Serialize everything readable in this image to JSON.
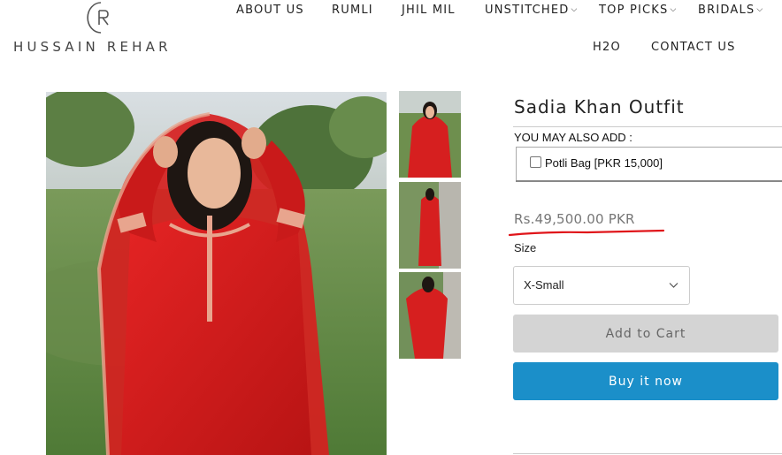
{
  "brand": {
    "name": "HUSSAIN REHAR",
    "logo_icon": "hr-monogram-icon"
  },
  "nav": {
    "items": [
      {
        "label": "ABOUT US",
        "has_dropdown": false
      },
      {
        "label": "RUMLI",
        "has_dropdown": false
      },
      {
        "label": "JHIL MIL",
        "has_dropdown": false
      },
      {
        "label": "UNSTITCHED",
        "has_dropdown": true
      },
      {
        "label": "TOP PICKS",
        "has_dropdown": true
      },
      {
        "label": "BRIDALS",
        "has_dropdown": true
      },
      {
        "label": "H2O",
        "has_dropdown": false
      },
      {
        "label": "CONTACT US",
        "has_dropdown": false
      }
    ],
    "dropdown_icon": "chevron-down-icon"
  },
  "product": {
    "title": "Sadia Khan Outfit",
    "addons_label": "YOU MAY ALSO ADD :",
    "addon_item": "Potli Bag [PKR 15,000]",
    "addon_checked": false,
    "price": "Rs.49,500.00 PKR",
    "size_label": "Size",
    "size_selected": "X-Small",
    "add_to_cart": "Add to Cart",
    "buy_now": "Buy it now"
  },
  "colors": {
    "outfit_red": "#d81e1e",
    "buy_button": "#1b8fc9",
    "cart_button": "#d4d4d4",
    "annotation_underline": "#e0151a"
  }
}
